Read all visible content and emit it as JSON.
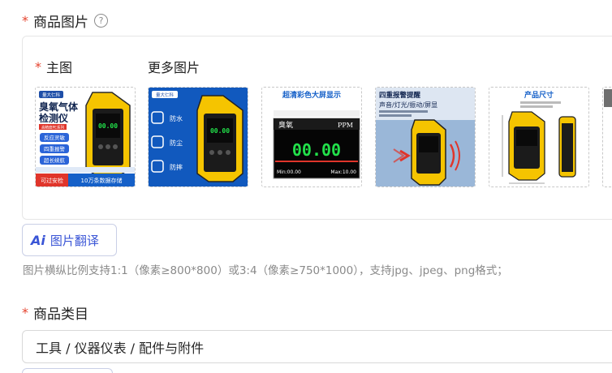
{
  "images_section": {
    "required_mark": "*",
    "title": "商品图片",
    "help_icon": "question-circle-icon",
    "main_label": "主图",
    "more_label": "更多图片"
  },
  "thumbs": {
    "t1": {
      "brand": "量大仁科",
      "line1": "臭氧气体",
      "line2": "检测仪",
      "tag": "高精度PE系列",
      "features": [
        "反应灵敏",
        "四重报警",
        "超长续航"
      ],
      "screen_value": "00.00",
      "badge": "可过安检",
      "storage": "10万条数据存储"
    },
    "t2": {
      "brand": "量大仁科",
      "features": [
        "防水",
        "防尘",
        "防摔"
      ],
      "screen_value": "00.00"
    },
    "t3": {
      "title": "超清彩色大屏显示",
      "gas": "臭氧",
      "unit": "PPM",
      "value": "00.00",
      "min": "Min:00.00",
      "max": "Max:10.00"
    },
    "t4": {
      "title": "四重报警提醒",
      "sub": "声音/灯光/振动/屏显"
    },
    "t5": {
      "title": "产品尺寸"
    }
  },
  "translate_button": {
    "icon_text": "Ai",
    "label": "图片翻译"
  },
  "hint_text": "图片横纵比例支持1:1（像素≥800*800）或3:4（像素≥750*1000），支持jpg、jpeg、png格式；",
  "category_section": {
    "required_mark": "*",
    "title": "商品类目",
    "value": "工具 / 仪器仪表 / 配件与附件"
  },
  "colors": {
    "required": "#e5432e",
    "accent": "#3a55d6",
    "device_yellow": "#f5c400",
    "screen_green": "#22e04a",
    "banner_blue": "#1560c8"
  }
}
